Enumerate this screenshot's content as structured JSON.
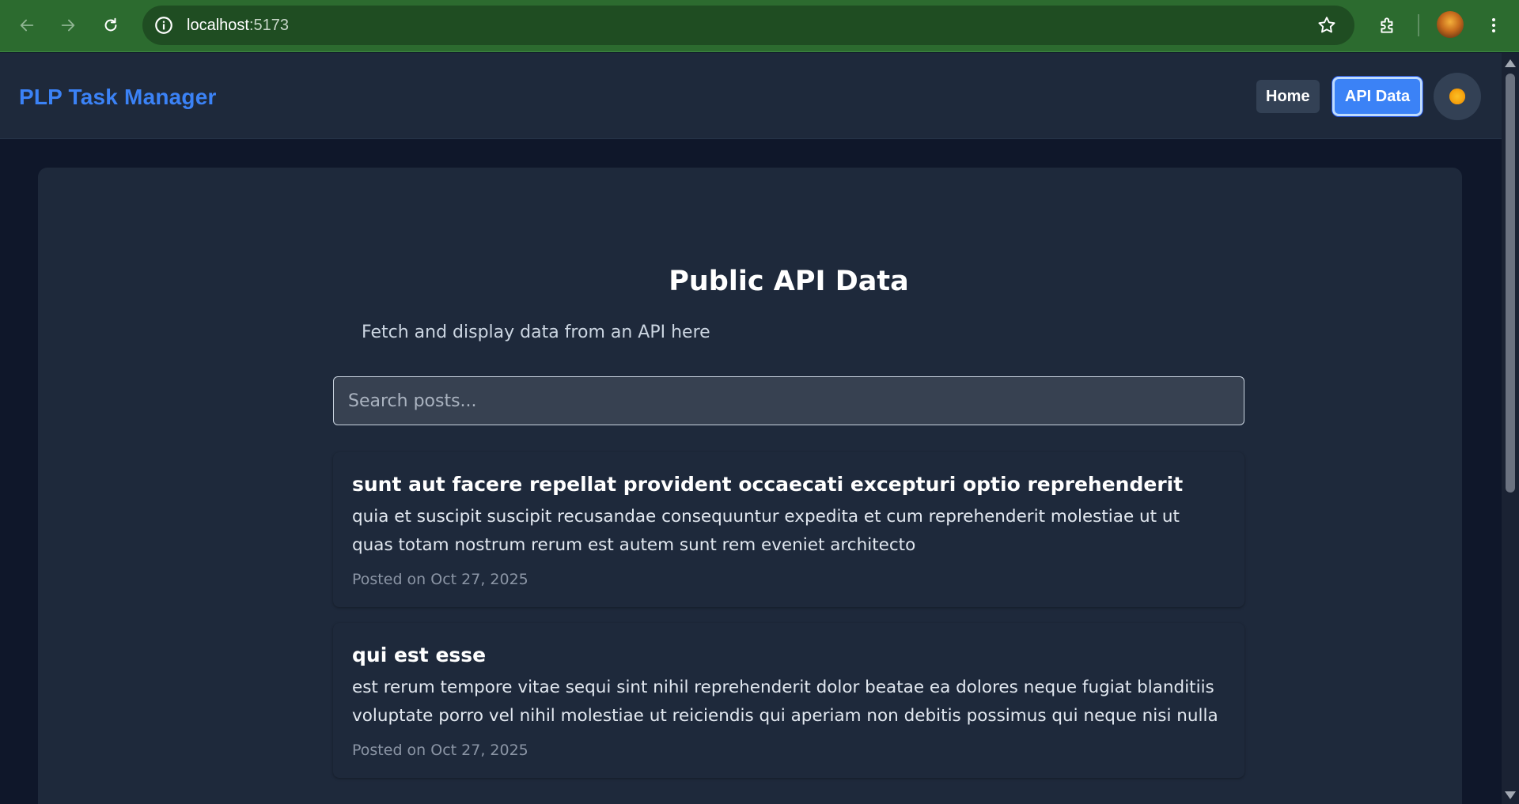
{
  "browser": {
    "url_host": "localhost",
    "url_port": ":5173",
    "icons": [
      "back-arrow-icon",
      "forward-arrow-icon",
      "reload-icon",
      "site-info-icon",
      "bookmark-star-icon",
      "extensions-icon",
      "profile-avatar",
      "more-menu-icon"
    ]
  },
  "header": {
    "brand": "PLP Task Manager",
    "nav": {
      "home_label": "Home",
      "api_label": "API Data"
    },
    "theme_icon": "sun-icon"
  },
  "main": {
    "title": "Public API Data",
    "subtitle": "Fetch and display data from an API here",
    "search": {
      "placeholder": "Search posts...",
      "value": ""
    },
    "posts": [
      {
        "title": "sunt aut facere repellat provident occaecati excepturi optio reprehenderit",
        "body": "quia et suscipit suscipit recusandae consequuntur expedita et cum reprehenderit molestiae ut ut quas totam nostrum rerum est autem sunt rem eveniet architecto",
        "date": "Posted on Oct 27, 2025"
      },
      {
        "title": "qui est esse",
        "body": "est rerum tempore vitae sequi sint nihil reprehenderit dolor beatae ea dolores neque fugiat blanditiis voluptate porro vel nihil molestiae ut reiciendis qui aperiam non debitis possimus qui neque nisi nulla",
        "date": "Posted on Oct 27, 2025"
      }
    ]
  },
  "colors": {
    "accent": "#3b82f6",
    "page_bg": "#0f172a",
    "panel_bg": "#1e293b",
    "chrome_bg": "#2c6b2f"
  }
}
